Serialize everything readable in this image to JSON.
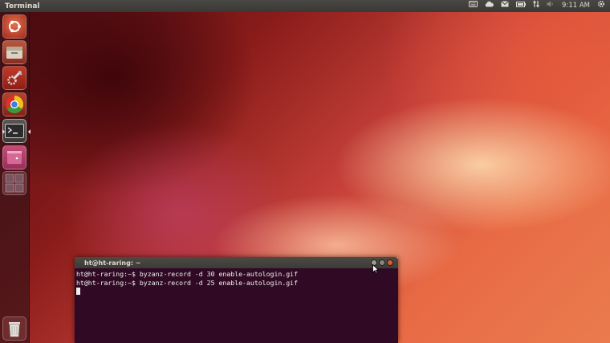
{
  "top_panel": {
    "app_title": "Terminal",
    "clock": "9:11 AM",
    "indicators": [
      "keyboard-icon",
      "cloud-icon",
      "mail-icon",
      "battery-icon",
      "network-icon",
      "volume-icon",
      "gear-icon"
    ]
  },
  "launcher": {
    "items": [
      "ubuntu-dash-icon",
      "files-icon",
      "settings-icon",
      "chrome-icon",
      "terminal-icon",
      "workspace-switcher-icon",
      "workspace-grid-icon",
      "trash-icon"
    ]
  },
  "terminal": {
    "title": "ht@ht-raring: ~",
    "lines": [
      "ht@ht-raring:~$ byzanz-record -d 30 enable-autologin.gif",
      "ht@ht-raring:~$ byzanz-record -d 25 enable-autologin.gif"
    ]
  },
  "colors": {
    "terminal_bg": "#300a24",
    "panel_bg": "#3c3b37",
    "close_button": "#e0582b"
  }
}
